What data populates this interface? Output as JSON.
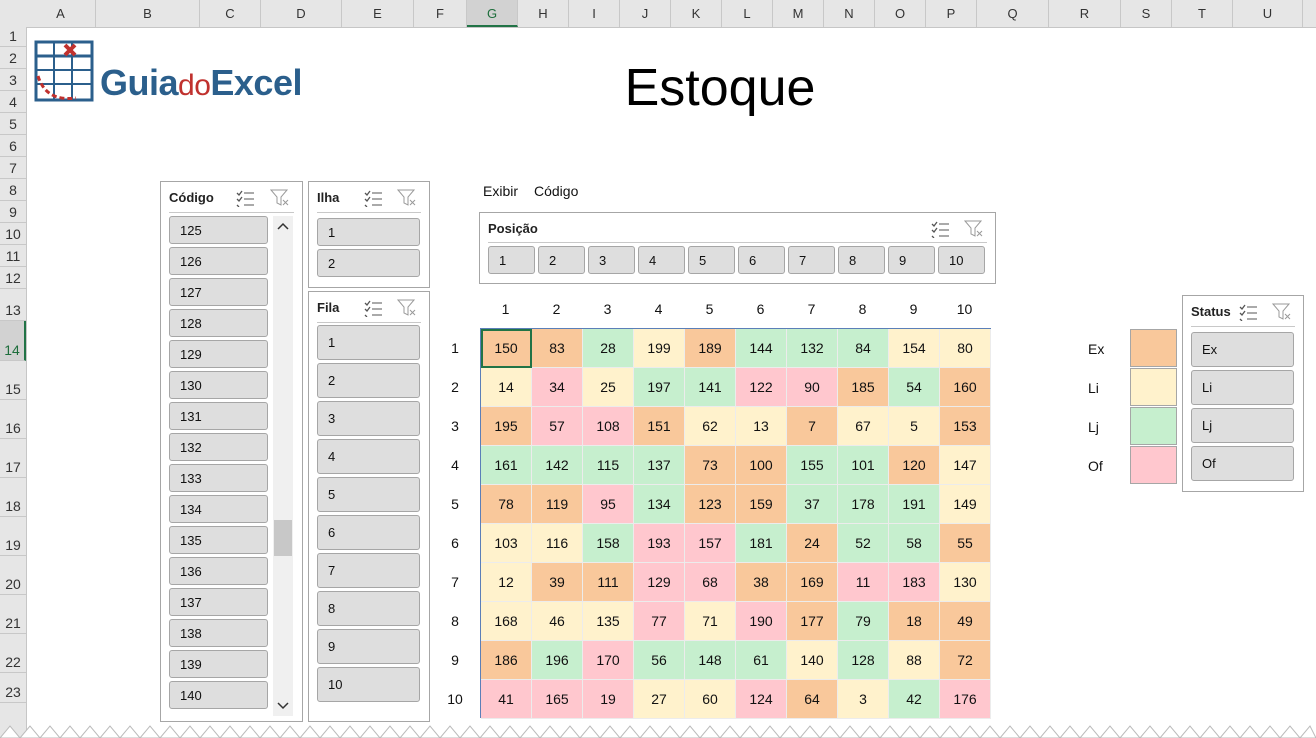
{
  "columns": [
    "A",
    "B",
    "C",
    "D",
    "E",
    "F",
    "G",
    "H",
    "I",
    "J",
    "K",
    "L",
    "M",
    "N",
    "O",
    "P",
    "Q",
    "R",
    "S",
    "T",
    "U"
  ],
  "selected_column": "G",
  "rows": [
    "1",
    "2",
    "3",
    "4",
    "5",
    "6",
    "7",
    "8",
    "9",
    "10",
    "11",
    "12",
    "13",
    "14",
    "15",
    "16",
    "17",
    "18",
    "19",
    "20",
    "21",
    "22",
    "23"
  ],
  "selected_row": "14",
  "logo": {
    "text_a": "Guia",
    "text_b": "do",
    "text_c": "Excel"
  },
  "title": "Estoque",
  "exibir_label": "Exibir",
  "exibir_value": "Código",
  "slicer_codigo": {
    "title": "Código",
    "items": [
      "125",
      "126",
      "127",
      "128",
      "129",
      "130",
      "131",
      "132",
      "133",
      "134",
      "135",
      "136",
      "137",
      "138",
      "139",
      "140"
    ]
  },
  "slicer_ilha": {
    "title": "Ilha",
    "items": [
      "1",
      "2"
    ]
  },
  "slicer_fila": {
    "title": "Fila",
    "items": [
      "1",
      "2",
      "3",
      "4",
      "5",
      "6",
      "7",
      "8",
      "9",
      "10"
    ]
  },
  "slicer_posicao": {
    "title": "Posição",
    "items": [
      "1",
      "2",
      "3",
      "4",
      "5",
      "6",
      "7",
      "8",
      "9",
      "10"
    ]
  },
  "slicer_status": {
    "title": "Status",
    "items": [
      "Ex",
      "Li",
      "Lj",
      "Of"
    ]
  },
  "grid_col_labels": [
    "1",
    "2",
    "3",
    "4",
    "5",
    "6",
    "7",
    "8",
    "9",
    "10"
  ],
  "grid_row_labels": [
    "1",
    "2",
    "3",
    "4",
    "5",
    "6",
    "7",
    "8",
    "9",
    "10"
  ],
  "grid_values": [
    [
      "150",
      "83",
      "28",
      "199",
      "189",
      "144",
      "132",
      "84",
      "154",
      "80"
    ],
    [
      "14",
      "34",
      "25",
      "197",
      "141",
      "122",
      "90",
      "185",
      "54",
      "160"
    ],
    [
      "195",
      "57",
      "108",
      "151",
      "62",
      "13",
      "7",
      "67",
      "5",
      "153"
    ],
    [
      "161",
      "142",
      "115",
      "137",
      "73",
      "100",
      "155",
      "101",
      "120",
      "147"
    ],
    [
      "78",
      "119",
      "95",
      "134",
      "123",
      "159",
      "37",
      "178",
      "191",
      "149"
    ],
    [
      "103",
      "116",
      "158",
      "193",
      "157",
      "181",
      "24",
      "52",
      "58",
      "55"
    ],
    [
      "12",
      "39",
      "111",
      "129",
      "68",
      "38",
      "169",
      "11",
      "183",
      "130"
    ],
    [
      "168",
      "46",
      "135",
      "77",
      "71",
      "190",
      "177",
      "79",
      "18",
      "49"
    ],
    [
      "186",
      "196",
      "170",
      "56",
      "148",
      "61",
      "140",
      "128",
      "88",
      "72"
    ],
    [
      "41",
      "165",
      "19",
      "27",
      "60",
      "124",
      "64",
      "3",
      "42",
      "176"
    ]
  ],
  "grid_status": [
    [
      "Ex",
      "Ex",
      "Lj",
      "Li",
      "Ex",
      "Lj",
      "Lj",
      "Lj",
      "Li",
      "Li"
    ],
    [
      "Li",
      "Of",
      "Li",
      "Lj",
      "Lj",
      "Of",
      "Of",
      "Ex",
      "Lj",
      "Ex"
    ],
    [
      "Ex",
      "Of",
      "Of",
      "Ex",
      "Li",
      "Li",
      "Ex",
      "Li",
      "Li",
      "Ex"
    ],
    [
      "Lj",
      "Lj",
      "Lj",
      "Lj",
      "Ex",
      "Ex",
      "Lj",
      "Lj",
      "Ex",
      "Li"
    ],
    [
      "Ex",
      "Ex",
      "Of",
      "Lj",
      "Ex",
      "Ex",
      "Lj",
      "Lj",
      "Lj",
      "Li"
    ],
    [
      "Li",
      "Li",
      "Lj",
      "Of",
      "Of",
      "Lj",
      "Ex",
      "Lj",
      "Lj",
      "Ex"
    ],
    [
      "Li",
      "Ex",
      "Ex",
      "Of",
      "Of",
      "Ex",
      "Ex",
      "Of",
      "Of",
      "Li"
    ],
    [
      "Li",
      "Li",
      "Li",
      "Of",
      "Li",
      "Of",
      "Ex",
      "Lj",
      "Ex",
      "Ex"
    ],
    [
      "Ex",
      "Lj",
      "Of",
      "Lj",
      "Lj",
      "Lj",
      "Li",
      "Lj",
      "Li",
      "Ex"
    ],
    [
      "Of",
      "Of",
      "Of",
      "Li",
      "Li",
      "Of",
      "Ex",
      "Li",
      "Lj",
      "Of"
    ]
  ],
  "legend": [
    {
      "label": "Ex",
      "color": "#f9c89b"
    },
    {
      "label": "Li",
      "color": "#fff2cc"
    },
    {
      "label": "Lj",
      "color": "#c6efce"
    },
    {
      "label": "Of",
      "color": "#ffc7ce"
    }
  ],
  "status_colors": {
    "Ex": "#f9c89b",
    "Li": "#fff2cc",
    "Lj": "#c6efce",
    "Of": "#ffc7ce"
  },
  "accent": "#217346"
}
